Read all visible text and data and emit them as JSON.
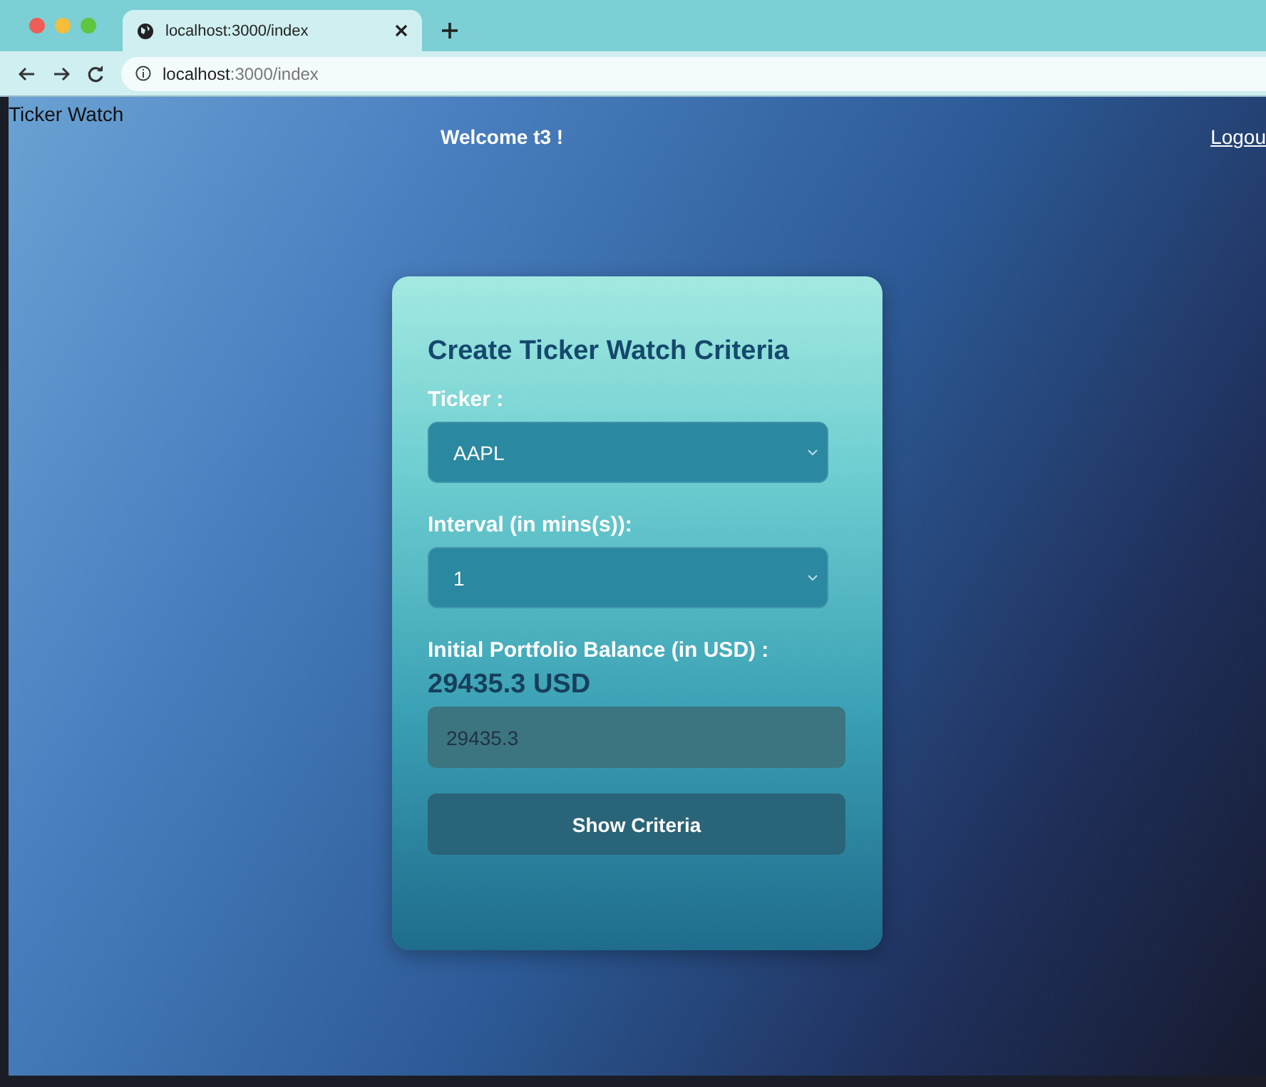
{
  "browser": {
    "tabs": [
      {
        "title": "localhost:3000/index",
        "selected": true
      }
    ],
    "address": "**localhost**:3000/index"
  },
  "header": {
    "brand": "Ticker Watch",
    "welcome": "Welcome t3 !",
    "logout": "Logou"
  },
  "form": {
    "title": "Create Ticker Watch Criteria",
    "fields": [
      {
        "kind": "select",
        "label": "Ticker :",
        "value": "AAPL"
      },
      {
        "kind": "select",
        "label": "Interval (in mins(s)):",
        "value": "1"
      },
      {
        "kind": "input",
        "label": "Initial Portfolio Balance (in USD) :",
        "display": "29435.3 USD",
        "value": "29435.3"
      }
    ],
    "button": "Show Criteria"
  }
}
